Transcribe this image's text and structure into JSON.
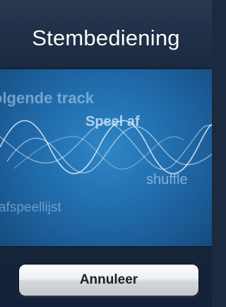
{
  "header": {
    "title": "Stembediening"
  },
  "voice_panel": {
    "phrases": [
      "olgende track",
      "Speel af",
      "shuffle",
      "afspeellijst"
    ]
  },
  "footer": {
    "cancel_label": "Annuleer"
  },
  "colors": {
    "header_bg": "#22324a",
    "panel_blue": "#2270b0",
    "button_text": "#1c1f24"
  }
}
